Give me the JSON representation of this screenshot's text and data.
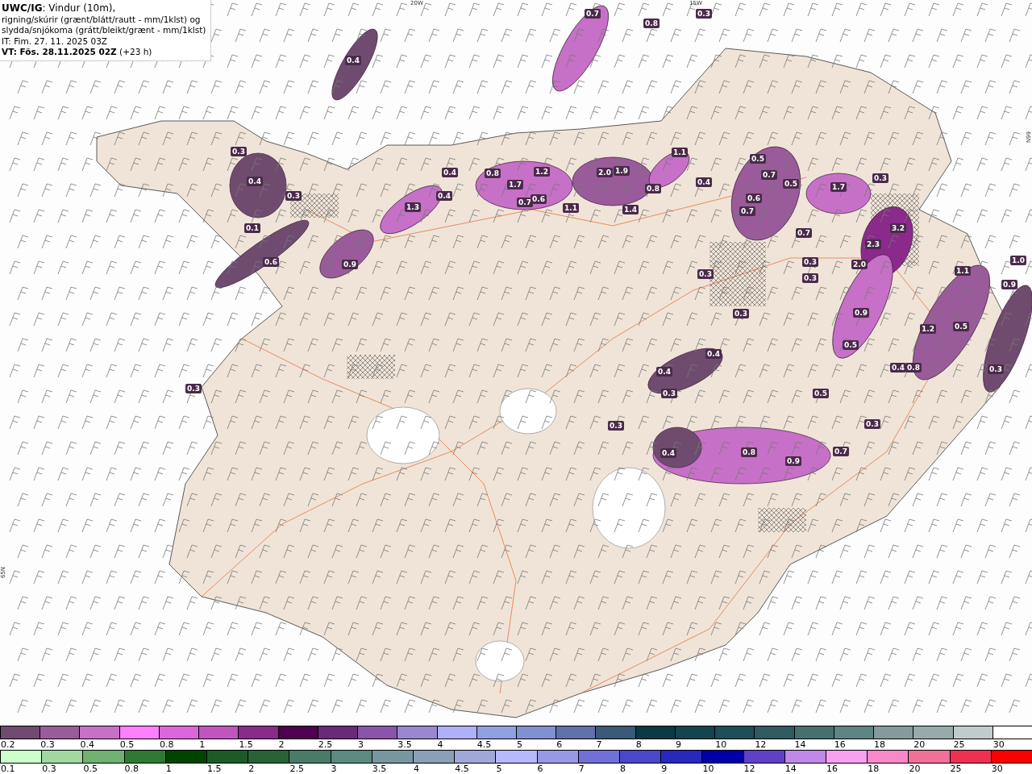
{
  "header": {
    "lines": [
      "**UWC/IG**: Vindur (10m),",
      "rigning/skúrir (grænt/blátt/rautt - mm/1klst) og",
      "slydda/snjókoma (grátt/bleikt/grænt - mm/1klst)",
      "IT: Fim. 27. 11. 2025 03Z",
      "**VT: Fös. 28.11.2025 02Z** (+23 h)"
    ]
  },
  "map": {
    "grid_labels": [
      "20W",
      "15W",
      "66N",
      "65N"
    ],
    "values": [
      "0.7",
      "0.8",
      "0.3",
      "0.4",
      "0.3",
      "0.4",
      "0.3",
      "0.1",
      "0.6",
      "0.9",
      "1.3",
      "0.4",
      "0.4",
      "0.8",
      "1.7",
      "1.2",
      "0.7",
      "0.6",
      "1.1",
      "2.0",
      "1.9",
      "0.8",
      "1.4",
      "1.1",
      "0.4",
      "0.5",
      "0.7",
      "0.6",
      "0.5",
      "1.7",
      "0.3",
      "0.7",
      "0.7",
      "2.3",
      "3.2",
      "2.0",
      "0.3",
      "0.3",
      "1.1",
      "1.0",
      "0.9",
      "0.9",
      "0.3",
      "1.2",
      "0.5",
      "0.4",
      "0.4",
      "0.3",
      "0.5",
      "0.4",
      "0.8",
      "0.3",
      "0.5",
      "0.3",
      "0.3",
      "0.4",
      "0.8",
      "0.9",
      "0.7",
      "0.3",
      "0.3"
    ]
  },
  "legends": [
    {
      "items": [
        {
          "label": "0.2",
          "color": "#6f4c6f"
        },
        {
          "label": "0.3",
          "color": "#9a5b9a"
        },
        {
          "label": "0.4",
          "color": "#c770c7"
        },
        {
          "label": "0.5",
          "color": "#ff80ff"
        },
        {
          "label": "0.8",
          "color": "#dd66dd"
        },
        {
          "label": "1",
          "color": "#c055c0"
        },
        {
          "label": "1.5",
          "color": "#8a2a8a"
        },
        {
          "label": "2",
          "color": "#500050"
        },
        {
          "label": "2.5",
          "color": "#6a2a7a"
        },
        {
          "label": "3",
          "color": "#8855aa"
        },
        {
          "label": "3.5",
          "color": "#9988d0"
        },
        {
          "label": "4",
          "color": "#b0b0f8"
        },
        {
          "label": "4.5",
          "color": "#90a0e0"
        },
        {
          "label": "5",
          "color": "#8090d0"
        },
        {
          "label": "6",
          "color": "#6070a8"
        },
        {
          "label": "7",
          "color": "#3a5a78"
        },
        {
          "label": "8",
          "color": "#0a3a44"
        },
        {
          "label": "9",
          "color": "#14444e"
        },
        {
          "label": "10",
          "color": "#1e4e58"
        },
        {
          "label": "12",
          "color": "#2e5a60"
        },
        {
          "label": "14",
          "color": "#46706e"
        },
        {
          "label": "16",
          "color": "#5e8484"
        },
        {
          "label": "18",
          "color": "#869a9c"
        },
        {
          "label": "20",
          "color": "#98aaaa"
        },
        {
          "label": "25",
          "color": "#c0cccc"
        },
        {
          "label": "30",
          "color": "#ffffff"
        }
      ]
    },
    {
      "items": [
        {
          "label": "0.1",
          "color": "#ccffcc"
        },
        {
          "label": "0.3",
          "color": "#a0d8a0"
        },
        {
          "label": "0.5",
          "color": "#70b070"
        },
        {
          "label": "0.8",
          "color": "#2e7a32"
        },
        {
          "label": "1",
          "color": "#004400"
        },
        {
          "label": "1.5",
          "color": "#1e5a28"
        },
        {
          "label": "2",
          "color": "#2a6238"
        },
        {
          "label": "2.5",
          "color": "#4a7a68"
        },
        {
          "label": "3",
          "color": "#5a8a80"
        },
        {
          "label": "3.5",
          "color": "#7896a0"
        },
        {
          "label": "4",
          "color": "#8aa0b8"
        },
        {
          "label": "4.5",
          "color": "#a0a8d8"
        },
        {
          "label": "5",
          "color": "#b8b8ff"
        },
        {
          "label": "6",
          "color": "#9898e8"
        },
        {
          "label": "7",
          "color": "#7070d8"
        },
        {
          "label": "8",
          "color": "#4848c8"
        },
        {
          "label": "9",
          "color": "#2828c0"
        },
        {
          "label": "10",
          "color": "#0000a8"
        },
        {
          "label": "12",
          "color": "#6040c8"
        },
        {
          "label": "14",
          "color": "#c088e8"
        },
        {
          "label": "16",
          "color": "#f8a0f0"
        },
        {
          "label": "18",
          "color": "#f888c8"
        },
        {
          "label": "20",
          "color": "#f07098"
        },
        {
          "label": "25",
          "color": "#f03050"
        },
        {
          "label": "30",
          "color": "#ff0000"
        }
      ]
    }
  ]
}
